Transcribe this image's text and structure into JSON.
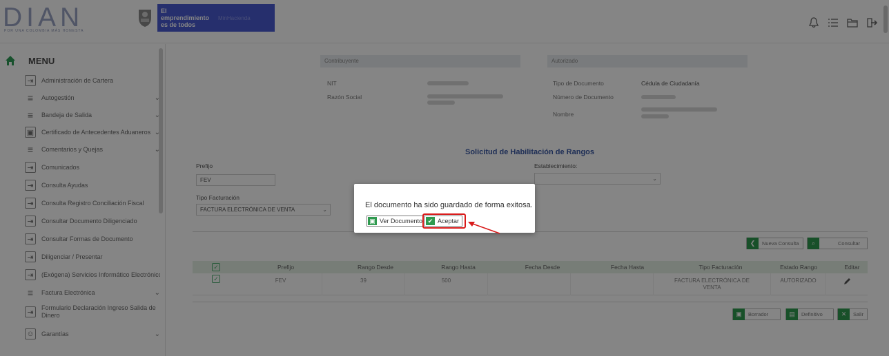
{
  "header": {
    "logo_text": "DIAN",
    "logo_tagline": "POR UNA COLOMBIA MÁS HONESTA",
    "banner_line1": "El emprendimiento es de todos",
    "banner_line2": "MinHacienda",
    "icons": [
      "bell-icon",
      "list-icon",
      "folder-icon",
      "logout-icon"
    ]
  },
  "sidebar": {
    "title": "MENU",
    "items": [
      {
        "label": "Administración de Cartera",
        "icon": "login-icon",
        "chevron": false
      },
      {
        "label": "Autogestión",
        "icon": "lines-icon",
        "chevron": true
      },
      {
        "label": "Bandeja de Salida",
        "icon": "lines-icon",
        "chevron": true
      },
      {
        "label": "Certificado de Antecedentes Aduaneros",
        "icon": "id-card-icon",
        "chevron": true
      },
      {
        "label": "Comentarios y Quejas",
        "icon": "lines-icon",
        "chevron": true
      },
      {
        "label": "Comunicados",
        "icon": "login-icon",
        "chevron": false
      },
      {
        "label": "Consulta Ayudas",
        "icon": "login-icon",
        "chevron": false
      },
      {
        "label": "Consulta Registro Conciliación Fiscal",
        "icon": "login-icon",
        "chevron": false
      },
      {
        "label": "Consultar Documento Diligenciado",
        "icon": "login-icon",
        "chevron": false
      },
      {
        "label": "Consultar Formas de Documento",
        "icon": "login-icon",
        "chevron": false
      },
      {
        "label": "Diligenciar / Presentar",
        "icon": "login-icon",
        "chevron": false
      },
      {
        "label": "(Exógena) Servicios Informático Electrónico",
        "icon": "login-icon",
        "chevron": false
      },
      {
        "label": "Factura Electrónica",
        "icon": "lines-icon",
        "chevron": true
      },
      {
        "label": "Formulario Declaración Ingreso Salida de Dinero",
        "icon": "login-icon",
        "chevron": false
      },
      {
        "label": "Garantías",
        "icon": "user-icon",
        "chevron": true
      }
    ]
  },
  "contribuyente": {
    "title": "Contribuyente",
    "nit_label": "NIT",
    "razon_label": "Razón Social"
  },
  "autorizado": {
    "title": "Autorizado",
    "tipo_doc_label": "Tipo de Documento",
    "tipo_doc_value": "Cédula de Ciudadanía",
    "num_doc_label": "Número de Documento",
    "nombre_label": "Nombre"
  },
  "form": {
    "section_title": "Solicitud de Habilitación de Rangos",
    "prefijo_label": "Prefijo",
    "prefijo_value": "FEV",
    "establecimiento_label": "Establecimiento:",
    "tipo_fact_label": "Tipo Facturación",
    "tipo_fact_value": "FACTURA ELECTRÓNICA DE VENTA",
    "nueva_consulta": "Nueva Consulta",
    "consultar": "Consultar",
    "borrador": "Borrador",
    "definitivo": "Definitivo",
    "salir": "Salir"
  },
  "table": {
    "headers": [
      "Prefijo",
      "Rango Desde",
      "Rango Hasta",
      "Fecha Desde",
      "Fecha Hasta",
      "Tipo Facturación",
      "Estado Rango",
      "Editar"
    ],
    "row": {
      "prefijo": "FEV",
      "rango_desde": "39",
      "rango_hasta": "500",
      "fecha_desde": "",
      "fecha_hasta": "",
      "tipo_facturacion": "FACTURA ELECTRÓNICA DE VENTA",
      "estado": "AUTORIZADO"
    }
  },
  "modal": {
    "message": "El documento ha sido guardado de forma exitosa.",
    "ver_documento": "Ver Documento",
    "aceptar": "Aceptar",
    "highlight_color": "#d91a1a"
  }
}
